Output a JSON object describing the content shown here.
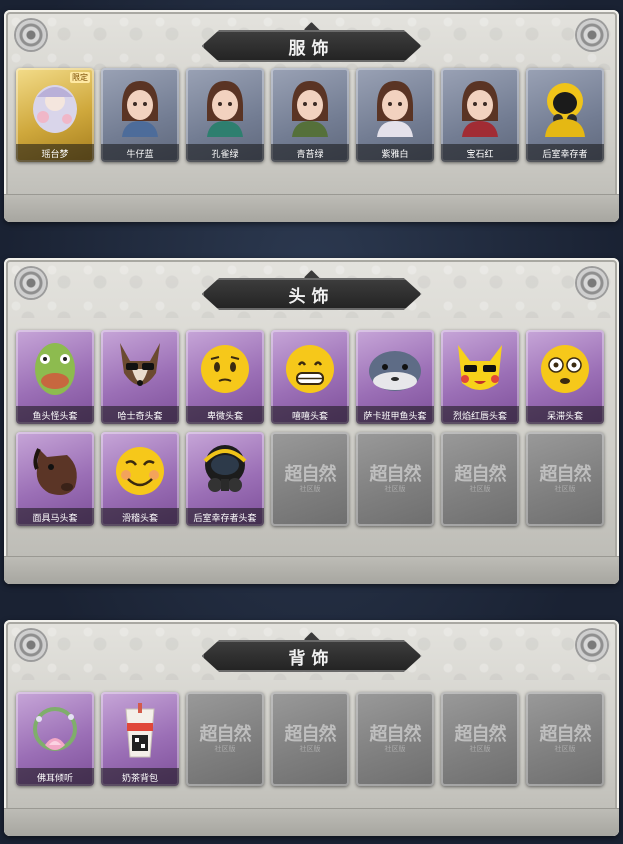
{
  "sections": [
    {
      "title": "服饰",
      "items": [
        {
          "name": "瑶台梦",
          "rarity": "gold",
          "badge": "限定",
          "icon": "dream-costume-icon"
        },
        {
          "name": "牛仔蓝",
          "rarity": "blue",
          "icon": "girl-costume-icon"
        },
        {
          "name": "孔雀绿",
          "rarity": "blue",
          "icon": "girl-costume-icon"
        },
        {
          "name": "青苔绿",
          "rarity": "blue",
          "icon": "girl-costume-icon"
        },
        {
          "name": "紫雅白",
          "rarity": "blue",
          "icon": "girl-costume-icon"
        },
        {
          "name": "宝石红",
          "rarity": "blue",
          "icon": "girl-costume-icon"
        },
        {
          "name": "后室幸存者",
          "rarity": "blue",
          "icon": "hazmat-costume-icon"
        }
      ]
    },
    {
      "title": "头饰",
      "items": [
        {
          "name": "鱼头怪头套",
          "rarity": "purple",
          "icon": "fish-mask-icon"
        },
        {
          "name": "哈士奇头套",
          "rarity": "purple",
          "icon": "husky-mask-icon"
        },
        {
          "name": "卑微头套",
          "rarity": "purple",
          "icon": "humble-emoji-mask-icon"
        },
        {
          "name": "嘻嘻头套",
          "rarity": "purple",
          "icon": "grin-emoji-mask-icon"
        },
        {
          "name": "萨卡班甲鱼头套",
          "rarity": "purple",
          "icon": "sacabambaspis-mask-icon"
        },
        {
          "name": "烈焰红唇头套",
          "rarity": "purple",
          "icon": "yellow-creature-mask-icon"
        },
        {
          "name": "呆滞头套",
          "rarity": "purple",
          "icon": "dazed-emoji-mask-icon"
        },
        {
          "name": "面具马头套",
          "rarity": "purple",
          "icon": "horse-mask-icon"
        },
        {
          "name": "滑稽头套",
          "rarity": "purple",
          "icon": "funny-emoji-mask-icon"
        },
        {
          "name": "后室幸存者头套",
          "rarity": "purple",
          "icon": "gas-mask-icon"
        },
        {
          "name": "",
          "rarity": "empty",
          "icon": "placeholder-icon"
        },
        {
          "name": "",
          "rarity": "empty",
          "icon": "placeholder-icon"
        },
        {
          "name": "",
          "rarity": "empty",
          "icon": "placeholder-icon"
        },
        {
          "name": "",
          "rarity": "empty",
          "icon": "placeholder-icon"
        }
      ]
    },
    {
      "title": "背饰",
      "items": [
        {
          "name": "佛耳倾听",
          "rarity": "purple",
          "icon": "lotus-wreath-icon"
        },
        {
          "name": "奶茶背包",
          "rarity": "purple",
          "icon": "milk-tea-backpack-icon"
        },
        {
          "name": "",
          "rarity": "empty",
          "icon": "placeholder-icon"
        },
        {
          "name": "",
          "rarity": "empty",
          "icon": "placeholder-icon"
        },
        {
          "name": "",
          "rarity": "empty",
          "icon": "placeholder-icon"
        },
        {
          "name": "",
          "rarity": "empty",
          "icon": "placeholder-icon"
        },
        {
          "name": "",
          "rarity": "empty",
          "icon": "placeholder-icon"
        }
      ]
    }
  ],
  "watermark": {
    "main": "超自然",
    "sub": "社区版"
  },
  "colors": {
    "gold": "#cfa83c",
    "blue": "#737d93",
    "purple": "#9b6fb6",
    "empty": "#7e7e7e",
    "title_bar": "#2e2e2e"
  }
}
